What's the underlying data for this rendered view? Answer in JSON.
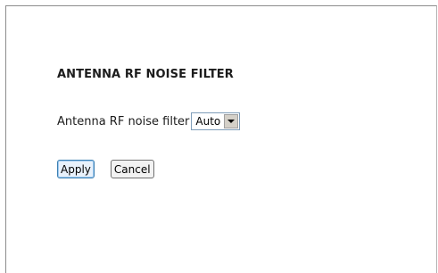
{
  "section": {
    "title": "ANTENNA RF NOISE FILTER"
  },
  "filter_row": {
    "label": "Antenna RF noise filter",
    "select_value": "Auto",
    "arrow_icon": "chevron-down-icon"
  },
  "actions": {
    "apply_label": "Apply",
    "cancel_label": "Cancel"
  }
}
